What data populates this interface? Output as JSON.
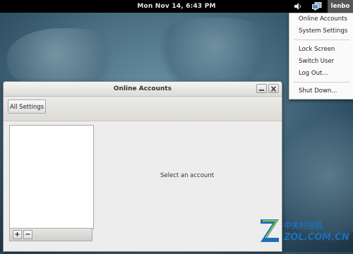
{
  "topbar": {
    "clock": "Mon Nov 14,  6:43 PM",
    "user": "lenbo"
  },
  "user_menu": {
    "items": [
      "Online Accounts",
      "System Settings",
      "Lock Screen",
      "Switch User",
      "Log Out...",
      "Shut Down..."
    ]
  },
  "window": {
    "title": "Online Accounts",
    "all_settings_label": "All Settings",
    "add_label": "+",
    "remove_label": "−",
    "empty_message": "Select an account"
  },
  "watermark": {
    "chinese": "中关村在线",
    "site": "ZOL.COM.CN"
  },
  "colors": {
    "topbar": "#000000",
    "user_highlight": "#565656",
    "watermark_blue": "#1e6fb8"
  }
}
